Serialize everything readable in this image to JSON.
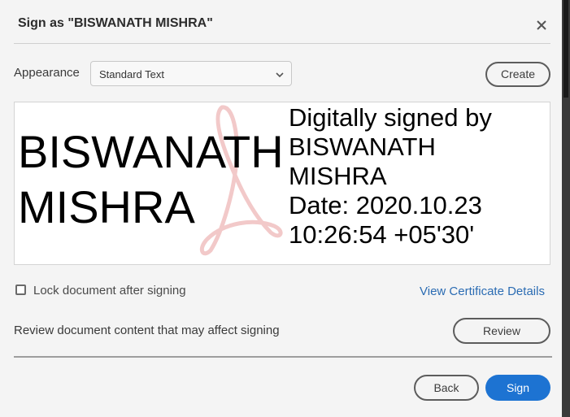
{
  "dialog": {
    "title": "Sign as \"BISWANATH MISHRA\"",
    "close_icon": "close-icon"
  },
  "appearance": {
    "label": "Appearance",
    "selected": "Standard Text",
    "create_label": "Create"
  },
  "preview": {
    "name_text": "BISWANATH MISHRA",
    "details_lines": [
      "Digitally signed by",
      "BISWANATH",
      "MISHRA",
      "Date: 2020.10.23",
      "10:26:54 +05'30'"
    ],
    "watermark_icon": "adobe-acrobat-watermark"
  },
  "options": {
    "lock_label": "Lock document after signing",
    "lock_checked": false,
    "cert_link": "View Certificate Details"
  },
  "review": {
    "text": "Review document content that may affect signing",
    "button_label": "Review"
  },
  "footer": {
    "back_label": "Back",
    "sign_label": "Sign"
  },
  "colors": {
    "accent": "#1d73d2",
    "link": "#2b6cb3",
    "background": "#f4f4f4"
  }
}
